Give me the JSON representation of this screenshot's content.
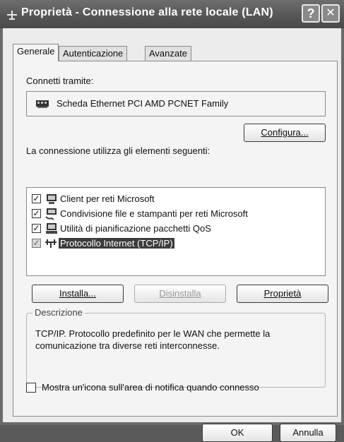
{
  "window": {
    "title": "Proprietà - Connessione alla rete locale (LAN)",
    "help_glyph": "?",
    "close_glyph": "✕"
  },
  "tabs": [
    "Generale",
    "Autenticazione",
    "Avanzate"
  ],
  "connect_using": {
    "label": "Connetti tramite:",
    "adapter": "Scheda Ethernet PCI AMD PCNET Family",
    "adapter_icon": "network-card-icon"
  },
  "configure_button": "Configura...",
  "components": {
    "label": "La connessione utilizza gli elementi seguenti:",
    "items": [
      {
        "label": "Client per reti Microsoft",
        "checked": true,
        "icon": "network-client-icon"
      },
      {
        "label": "Condivisione file e stampanti per reti Microsoft",
        "checked": true,
        "icon": "file-printer-sharing-icon"
      },
      {
        "label": "Utilità di pianificazione pacchetti QoS",
        "checked": true,
        "icon": "qos-scheduler-icon"
      },
      {
        "label": "Protocollo Internet (TCP/IP)",
        "checked": true,
        "selected": true,
        "icon": "protocol-icon"
      }
    ]
  },
  "buttons": {
    "install": "Installa...",
    "uninstall": "Disinstalla",
    "properties": "Proprietà",
    "ok": "OK",
    "cancel": "Annulla"
  },
  "description": {
    "legend": "Descrizione",
    "text": "TCP/IP. Protocollo predefinito per le WAN che permette la comunicazione tra diverse reti interconnesse."
  },
  "notify_checkbox": {
    "label": "Mostra un'icona sull'area di notifica quando connesso",
    "checked": false
  }
}
